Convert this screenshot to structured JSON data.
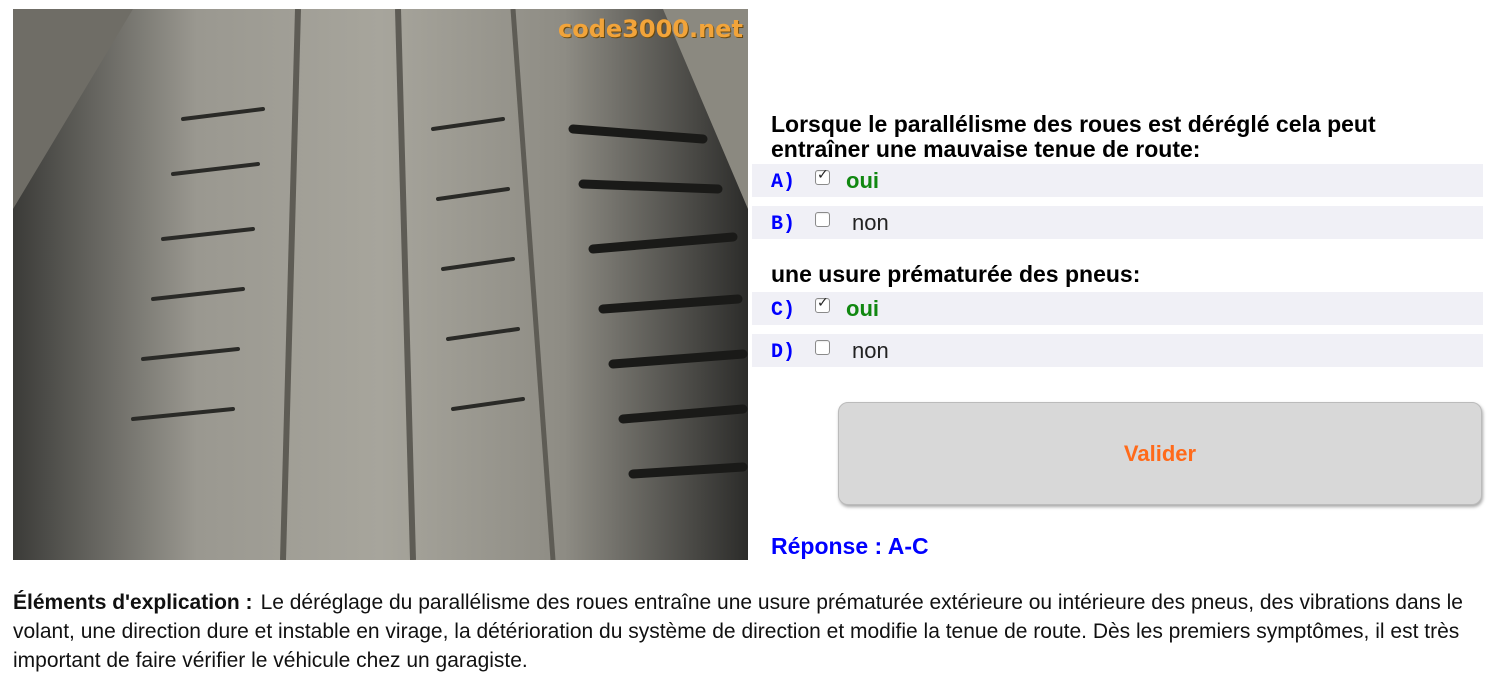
{
  "photo": {
    "watermark": "code3000.net",
    "subject": "tire-tread"
  },
  "questions": [
    {
      "text": "Lorsque le parallélisme des roues est déréglé cela peut entraîner une mauvaise tenue de route:",
      "options": [
        {
          "letter": "A)",
          "label": "oui",
          "checked": true
        },
        {
          "letter": "B)",
          "label": "non",
          "checked": false
        }
      ]
    },
    {
      "text": "une usure prématurée des pneus:",
      "options": [
        {
          "letter": "C)",
          "label": "oui",
          "checked": true
        },
        {
          "letter": "D)",
          "label": "non",
          "checked": false
        }
      ]
    }
  ],
  "validate_label": "Valider",
  "response": "Réponse : A-C",
  "explanation": {
    "lead": "Éléments d'explication :",
    "text": "Le déréglage du parallélisme des roues entraîne une usure prématurée extérieure ou intérieure des pneus, des vibrations dans le volant, une direction dure et instable en virage, la détérioration du système de direction et modifie la tenue de route. Dès les premiers symptômes, il est très important de faire vérifier le véhicule chez un garagiste."
  },
  "colors": {
    "accent_blue": "#0000ff",
    "correct_green": "#118811",
    "button_text": "#ff6a1a",
    "row_bg": "#f0f0f6"
  }
}
